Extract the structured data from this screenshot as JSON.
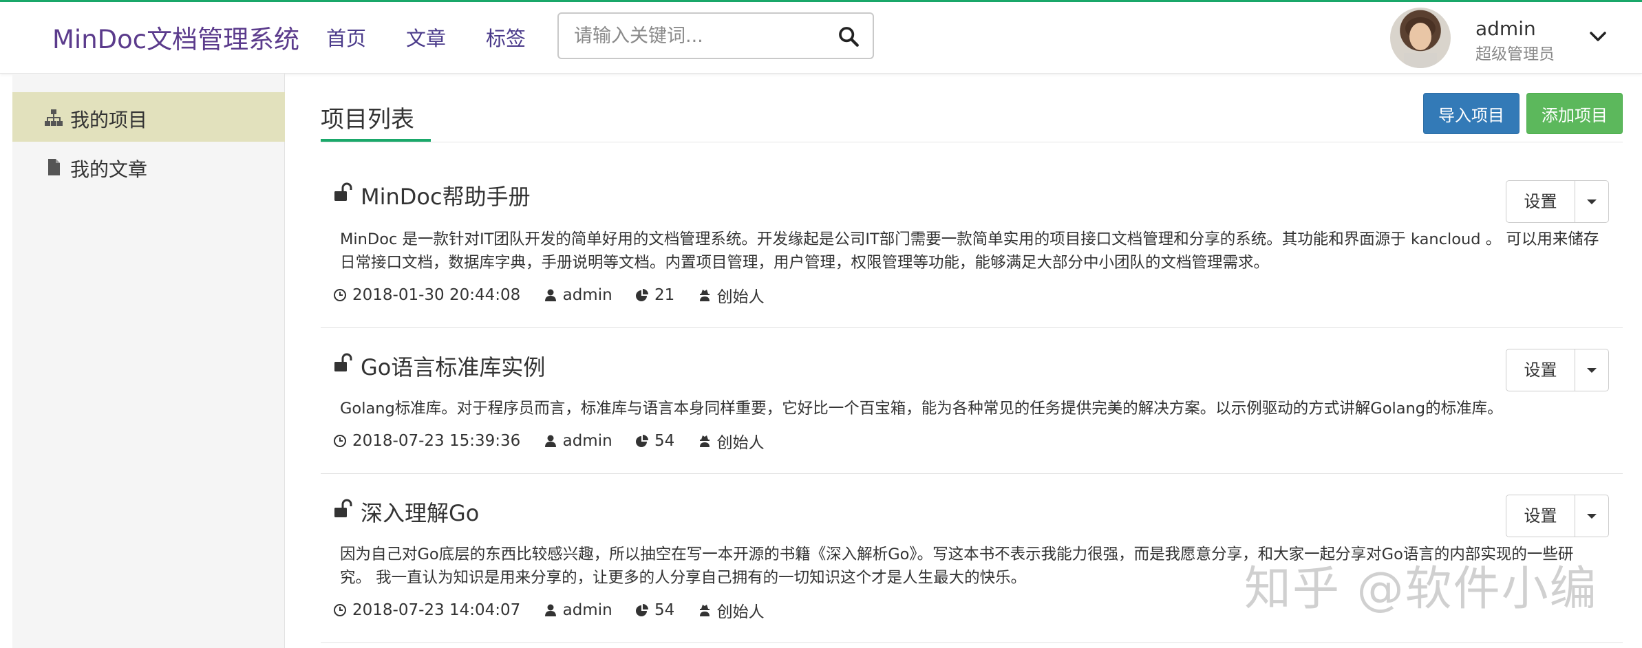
{
  "header": {
    "brand": "MinDoc文档管理系统",
    "nav": [
      "首页",
      "文章",
      "标签"
    ],
    "search_placeholder": "请输入关键词...",
    "user": {
      "name": "admin",
      "role": "超级管理员"
    }
  },
  "sidebar": {
    "items": [
      {
        "label": "我的项目",
        "icon": "sitemap-icon",
        "active": true
      },
      {
        "label": "我的文章",
        "icon": "file-icon",
        "active": false
      }
    ]
  },
  "main": {
    "title": "项目列表",
    "import_label": "导入项目",
    "add_label": "添加项目",
    "projects": [
      {
        "name": "MinDoc帮助手册",
        "desc": "MinDoc 是一款针对IT团队开发的简单好用的文档管理系统。开发缘起是公司IT部门需要一款简单实用的项目接口文档管理和分享的系统。其功能和界面源于 kancloud 。 可以用来储存日常接口文档，数据库字典，手册说明等文档。内置项目管理，用户管理，权限管理等功能，能够满足大部分中小团队的文档管理需求。",
        "date": "2018-01-30 20:44:08",
        "author": "admin",
        "docs": "21",
        "role": "创始人",
        "settings_label": "设置"
      },
      {
        "name": "Go语言标准库实例",
        "desc": "Golang标准库。对于程序员而言，标准库与语言本身同样重要，它好比一个百宝箱，能为各种常见的任务提供完美的解决方案。以示例驱动的方式讲解Golang的标准库。",
        "date": "2018-07-23 15:39:36",
        "author": "admin",
        "docs": "54",
        "role": "创始人",
        "settings_label": "设置"
      },
      {
        "name": "深入理解Go",
        "desc": "因为自己对Go底层的东西比较感兴趣，所以抽空在写一本开源的书籍《深入解析Go》。写这本书不表示我能力很强，而是我愿意分享，和大家一起分享对Go语言的内部实现的一些研究。 我一直认为知识是用来分享的，让更多的人分享自己拥有的一切知识这个才是人生最大的快乐。",
        "date": "2018-07-23 14:04:07",
        "author": "admin",
        "docs": "54",
        "role": "创始人",
        "settings_label": "设置"
      }
    ]
  },
  "watermark": "知乎 @软件小编",
  "colors": {
    "brand": "#5b3b8c",
    "accent": "#1aa86a",
    "primary": "#337ab7",
    "success": "#5cb85c",
    "active_bg": "#e2e1bd"
  }
}
